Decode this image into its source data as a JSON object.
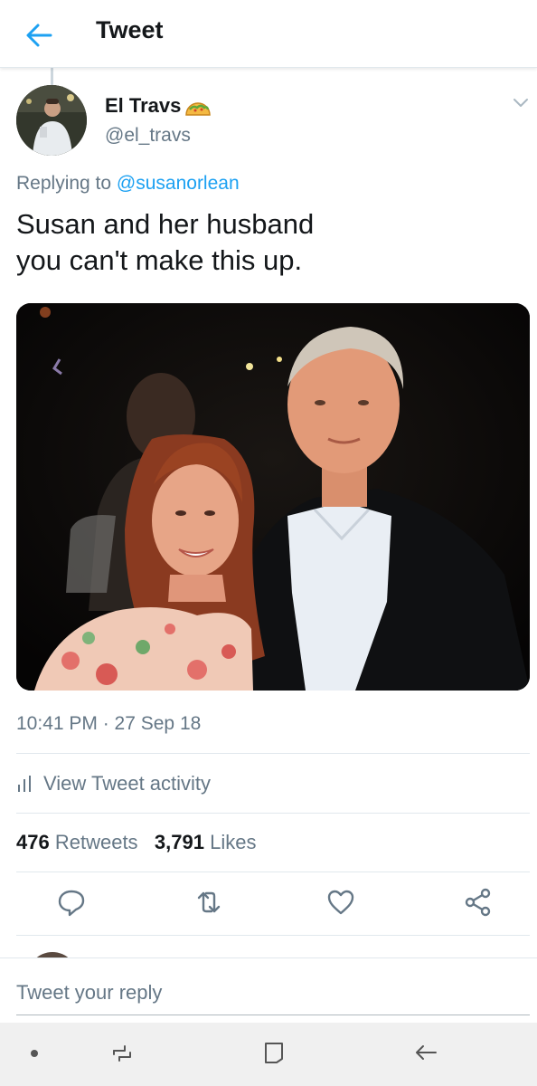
{
  "header": {
    "title": "Tweet",
    "back_icon": "arrow-left-icon"
  },
  "author": {
    "name": "El Travs",
    "handle": "@el_travs",
    "emoji_icon": "taco-icon"
  },
  "reply_context": {
    "prefix": "Replying to ",
    "mention": "@susanorlean"
  },
  "tweet": {
    "line1": "Susan and her husband",
    "line2": "you can't make this up.",
    "timestamp": "10:41 PM · 27 Sep 18"
  },
  "activity": {
    "label": "View Tweet activity",
    "icon": "bar-chart-icon"
  },
  "stats": {
    "retweets_count": "476",
    "retweets_label": "Retweets",
    "likes_count": "3,791",
    "likes_label": "Likes"
  },
  "actions": [
    "reply-icon",
    "retweet-icon",
    "like-icon",
    "share-icon"
  ],
  "reply_box": {
    "placeholder": "Tweet your reply"
  },
  "system_nav": [
    "dot-icon",
    "recent-apps-icon",
    "home-icon",
    "back-icon"
  ],
  "colors": {
    "accent": "#1da1f2",
    "secondary_text": "#657786",
    "divider": "#e1e8ed"
  }
}
